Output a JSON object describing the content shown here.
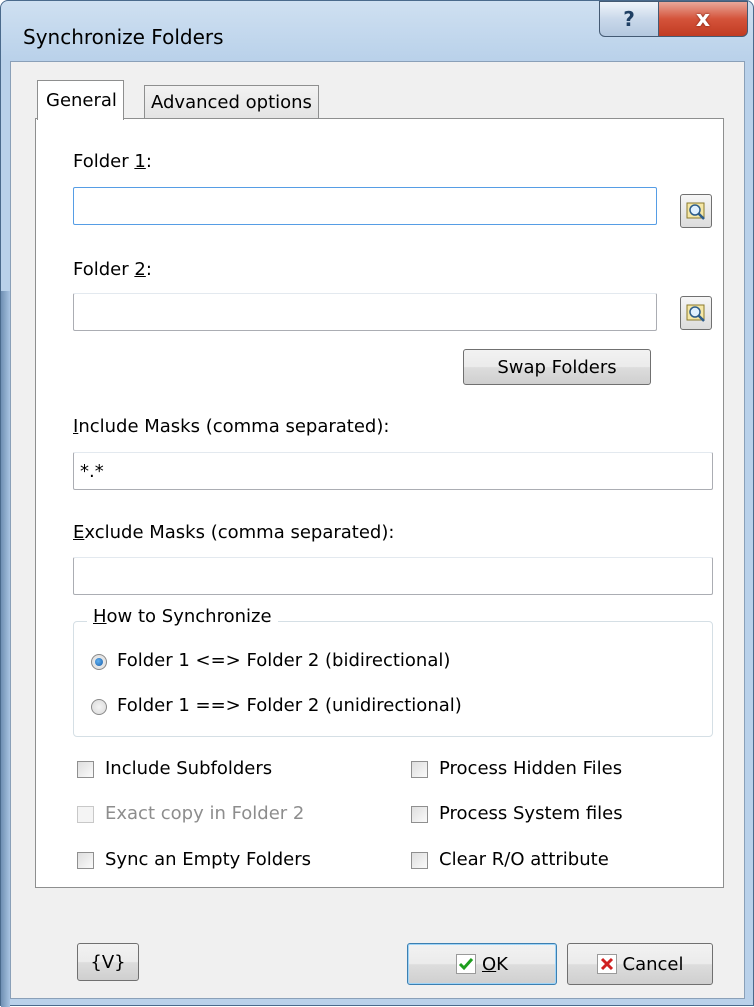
{
  "window": {
    "title": "Synchronize Folders"
  },
  "title_buttons": {
    "help": "?",
    "close": "x"
  },
  "tabs": [
    {
      "label": "General",
      "selected": true
    },
    {
      "label": "Advanced options",
      "selected": false
    }
  ],
  "folder1": {
    "label_pre": "Folder ",
    "label_accel": "1",
    "label_post": ":",
    "value": ""
  },
  "folder2": {
    "label_pre": "Folder ",
    "label_accel": "2",
    "label_post": ":",
    "value": ""
  },
  "swap_button": "Swap Folders",
  "include_masks": {
    "label_accel": "I",
    "label_rest": "nclude Masks (comma separated):",
    "value": "*.*"
  },
  "exclude_masks": {
    "label_accel": "E",
    "label_rest": "xclude Masks (comma separated):",
    "value": ""
  },
  "sync_group": {
    "title_accel": "H",
    "title_rest": "ow to Synchronize",
    "options": [
      {
        "label": "Folder 1 <=> Folder 2 (bidirectional)",
        "checked": true
      },
      {
        "label": "Folder 1 ==> Folder 2 (unidirectional)",
        "checked": false
      }
    ]
  },
  "checkboxes": {
    "include_subfolders": {
      "label": "Include Subfolders",
      "checked": false,
      "enabled": true
    },
    "exact_copy": {
      "label": "Exact copy in Folder 2",
      "checked": false,
      "enabled": false
    },
    "sync_empty": {
      "label": "Sync an Empty Folders",
      "checked": false,
      "enabled": true
    },
    "process_hidden": {
      "label": "Process Hidden Files",
      "checked": false,
      "enabled": true
    },
    "process_system": {
      "label": "Process System files",
      "checked": false,
      "enabled": true
    },
    "clear_ro": {
      "label": "Clear R/O attribute",
      "checked": false,
      "enabled": true
    }
  },
  "footer": {
    "variables_button": "{V}",
    "ok_accel": "O",
    "ok_rest": "K",
    "cancel": "Cancel"
  },
  "colors": {
    "accent": "#3c7fb1",
    "ok_check": "#1e9e1e",
    "cancel_x": "#d02020"
  }
}
